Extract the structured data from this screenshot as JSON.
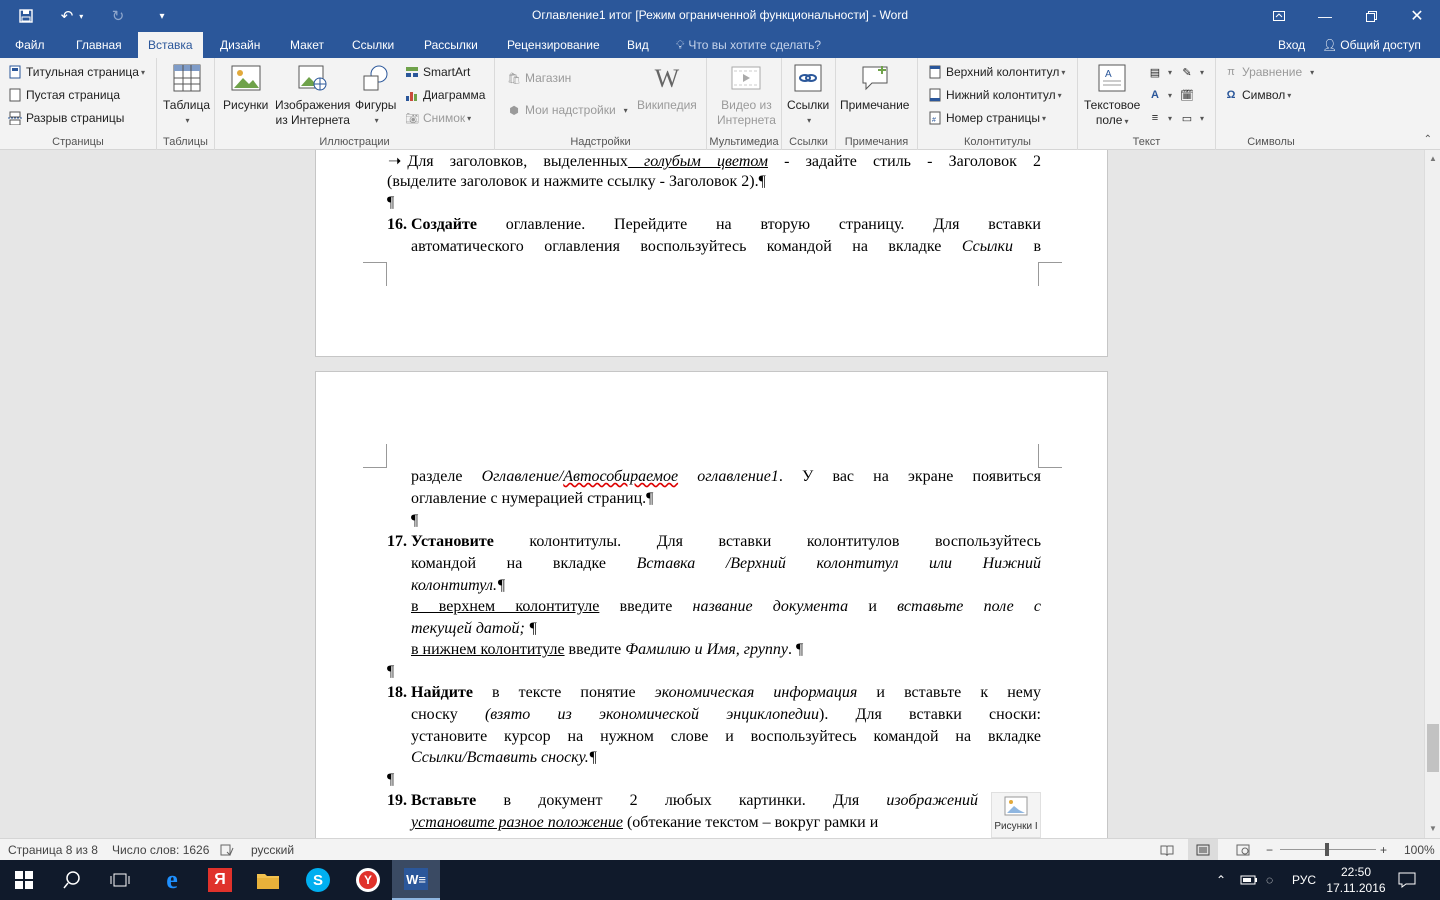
{
  "app": {
    "title": "Оглавление1 итог [Режим ограниченной функциональности] - Word",
    "accent": "#2b579a"
  },
  "tabs": [
    "Файл",
    "Главная",
    "Вставка",
    "Дизайн",
    "Макет",
    "Ссылки",
    "Рассылки",
    "Рецензирование",
    "Вид"
  ],
  "active_tab": "Вставка",
  "tell_me": "Что вы хотите сделать?",
  "signin": "Вход",
  "share": "Общий доступ",
  "ribbon": {
    "pages": {
      "label": "Страницы",
      "items": [
        "Титульная страница",
        "Пустая страница",
        "Разрыв страницы"
      ]
    },
    "tables": {
      "label": "Таблицы",
      "table": "Таблица"
    },
    "illustrations": {
      "label": "Иллюстрации",
      "pictures": "Рисунки",
      "online_line1": "Изображения",
      "online_line2": "из Интернета",
      "shapes": "Фигуры",
      "smartart": "SmartArt",
      "chart": "Диаграмма",
      "screenshot": "Снимок"
    },
    "addins": {
      "label": "Надстройки",
      "store": "Магазин",
      "my_addins": "Мои надстройки",
      "wikipedia": "Википедия"
    },
    "media": {
      "label": "Мультимедиа",
      "video_line1": "Видео из",
      "video_line2": "Интернета"
    },
    "links": {
      "label": "Ссылки",
      "links": "Ссылки"
    },
    "comments": {
      "label": "Примечания",
      "comment": "Примечание"
    },
    "headerfooter": {
      "label": "Колонтитулы",
      "header": "Верхний колонтитул",
      "footer": "Нижний колонтитул",
      "page_number": "Номер страницы"
    },
    "text": {
      "label": "Текст",
      "textbox_line1": "Текстовое",
      "textbox_line2": "поле"
    },
    "symbols": {
      "label": "Символы",
      "equation": "Уравнение",
      "symbol": "Символ"
    }
  },
  "doc": {
    "p1": {
      "l1_a": "Для заголовков, выделенных",
      "l1_b": " голубым цветом",
      "l1_c": " - задайте стиль - Заголовок 2",
      "l2": "(выделите заголовок и нажмите ссылку - Заголовок 2).¶",
      "pilcrow": "¶"
    },
    "p16": {
      "num": "16.",
      "bold": "Создайте",
      "l1": " оглавление. Перейдите на вторую страницу. Для вставки",
      "l2_a": "автоматического оглавления воспользуйтесь командой на вкладке ",
      "l2_b": "Ссылки",
      "l2_c": " в",
      "l3_a": "разделе ",
      "l3_b": "Оглавление/",
      "l3_c": "Автособираемое",
      "l3_d": " оглавление1",
      "l3_e": ". У вас на экране появиться",
      "l4": "оглавление с нумерацией страниц.¶",
      "pilcrow": "¶"
    },
    "p17": {
      "num": "17.",
      "bold": "Установите",
      "l1": " колонтитулы. Для вставки колонтитулов воспользуйтесь",
      "l2_a": "командой на вкладке ",
      "l2_b": "Вставка /Верхний колонтитул или Нижний",
      "l3": "колонтитул.¶",
      "l4_a": "в верхнем колонтитуле",
      "l4_b": " введите ",
      "l4_c": "название документа",
      "l4_d": " и ",
      "l4_e": "вставьте поле с",
      "l5": "текущей датой; ¶",
      "l6_a": "в нижнем колонтитуле",
      "l6_b": " введите ",
      "l6_c": "Фамилию и Имя, группу",
      "l6_d": ". ¶",
      "pilcrow": "¶"
    },
    "p18": {
      "num": "18.",
      "bold": "Найдите",
      "l1_a": " в тексте понятие ",
      "l1_b": "экономическая информация",
      "l1_c": " и вставьте к нему",
      "l2_a": "сноску ",
      "l2_b": "(взято из экономической энциклопедии",
      "l2_c": "). Для вставки сноски:",
      "l3": "установите курсор на нужном слове и воспользуйтесь командой на вкладке",
      "l4": "Ссылки/Вставить сноску.¶",
      "pilcrow": "¶"
    },
    "p19": {
      "num": "19.",
      "bold": "Вставьте",
      "l1_a": " в документ 2 любых картинки. Для ",
      "l1_b": "изображений",
      "l2_a": "установите разное положение",
      "l2_b": " (обтекание текстом – вокруг рамки и"
    },
    "float_label": "Рисунки I"
  },
  "status": {
    "page": "Страница 8 из 8",
    "words": "Число слов: 1626",
    "lang": "русский",
    "zoom": "100%"
  },
  "taskbar": {
    "lang": "РУС",
    "time": "22:50",
    "date": "17.11.2016"
  }
}
